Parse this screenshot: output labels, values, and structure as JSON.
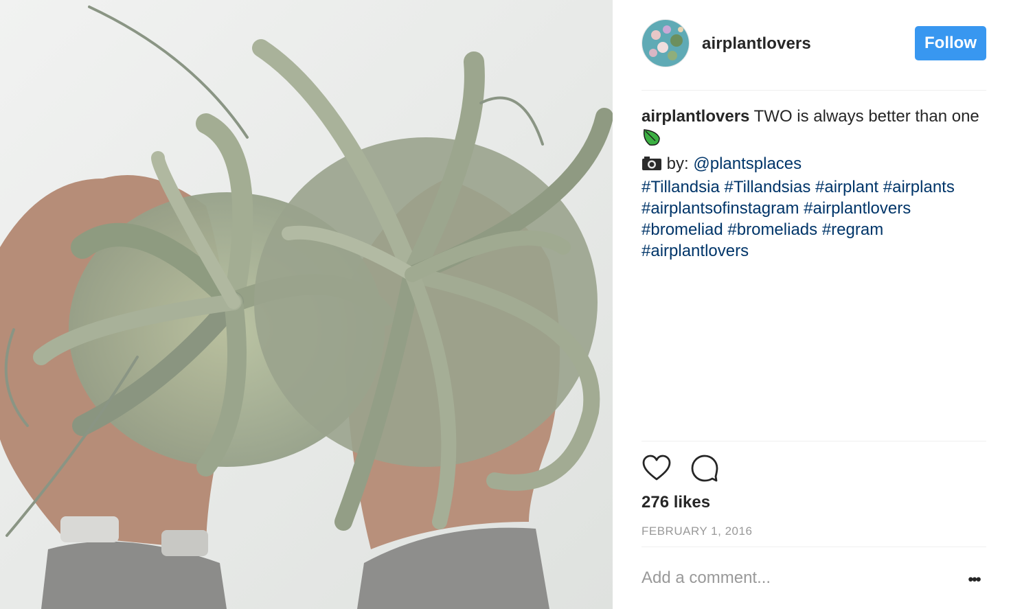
{
  "post": {
    "username": "airplantlovers",
    "follow_label": "Follow",
    "caption": {
      "username": "airplantlovers",
      "text": " TWO is always better than one",
      "by_text": " by: ",
      "mention": "@plantsplaces",
      "hashtags_line1": [
        "#Tillandsia",
        "#Tillandsias",
        "#airplant",
        "#airplants"
      ],
      "hashtags_line2": [
        "#airplantsofinstagram",
        "#airplantlovers"
      ],
      "hashtags_line3": [
        "#bromeliad",
        "#bromeliads",
        "#regram"
      ],
      "hashtags_line4": [
        "#airplantlovers"
      ]
    },
    "likes": "276 likes",
    "date": "FEBRUARY 1, 2016",
    "comment_placeholder": "Add a comment...",
    "more_label": "•••"
  },
  "colors": {
    "follow_button": "#3897f0",
    "hashtag_link": "#003569",
    "muted_text": "#999999"
  },
  "icons": {
    "like": "heart-icon",
    "comment": "comment-bubble-icon",
    "more": "more-options-icon"
  }
}
